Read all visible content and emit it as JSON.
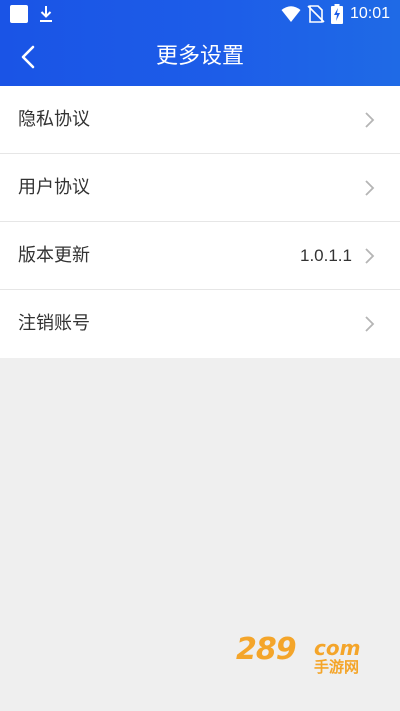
{
  "status_bar": {
    "time": "10:01"
  },
  "header": {
    "title": "更多设置"
  },
  "settings": {
    "items": [
      {
        "label": "隐私协议",
        "value": ""
      },
      {
        "label": "用户协议",
        "value": ""
      },
      {
        "label": "版本更新",
        "value": "1.0.1.1"
      },
      {
        "label": "注销账号",
        "value": ""
      }
    ]
  },
  "watermark": {
    "number": "289",
    "domain": "com",
    "text": "手游网"
  },
  "colors": {
    "header_bg": "#1d5de8",
    "page_bg": "#efefef",
    "list_bg": "#ffffff",
    "text": "#333333",
    "chevron": "#b5b5b5",
    "watermark": "#f4a52a"
  },
  "icons": {
    "back": "chevron-left-icon",
    "row_arrow": "chevron-right-icon",
    "download": "download-icon",
    "wifi": "wifi-icon",
    "no_sim": "no-sim-icon",
    "battery": "battery-charging-icon"
  }
}
